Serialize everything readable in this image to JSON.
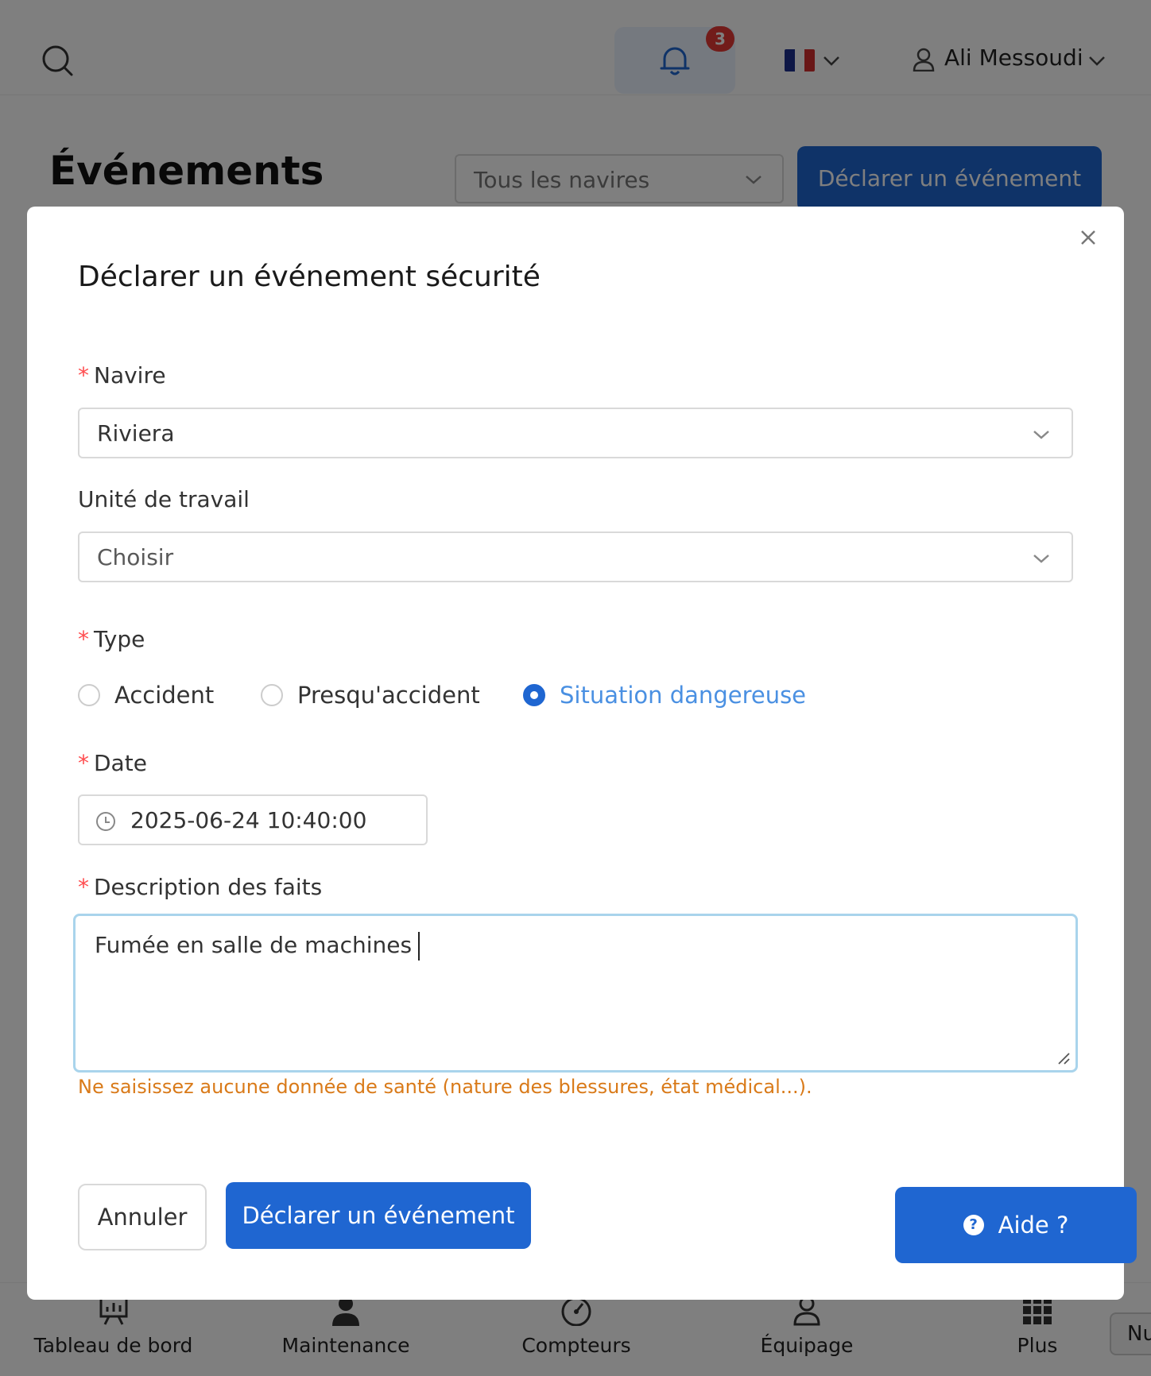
{
  "topbar": {
    "notification_count": "3",
    "language": "FR",
    "user_name": "Ali Messoudi"
  },
  "page": {
    "title": "Événements",
    "vessel_filter": "Tous les navires",
    "declare_button": "Déclarer un événement"
  },
  "modal": {
    "title": "Déclarer un événement sécurité",
    "fields": {
      "vessel": {
        "label": "Navire",
        "value": "Riviera",
        "required": true
      },
      "work_unit": {
        "label": "Unité de travail",
        "placeholder": "Choisir"
      },
      "type": {
        "label": "Type",
        "options": [
          "Accident",
          "Presqu'accident",
          "Situation dangereuse"
        ],
        "selected": "Situation dangereuse"
      },
      "date": {
        "label": "Date",
        "value": "2025-06-24 10:40:00"
      },
      "description": {
        "label": "Description des faits",
        "value": "Fumée en salle de machines",
        "warning": "Ne saisissez aucune donnée de santé (nature des blessures, état médical...)."
      }
    },
    "cancel_label": "Annuler",
    "submit_label": "Déclarer un événement",
    "required_mark": "*"
  },
  "help": {
    "label": "Aide ?",
    "icon": "question-icon"
  },
  "bottom_nav": [
    {
      "label": "Tableau de bord",
      "icon": "dashboard-icon"
    },
    {
      "label": "Maintenance",
      "icon": "maintenance-icon"
    },
    {
      "label": "Compteurs",
      "icon": "gauge-icon"
    },
    {
      "label": "Équipage",
      "icon": "crew-icon"
    },
    {
      "label": "Plus",
      "icon": "grid-icon"
    }
  ],
  "floating_tab": "Nu",
  "colors": {
    "primary": "#1f66d1",
    "warning": "#d97a19",
    "required": "#ff4d4f",
    "badge": "#e53935"
  }
}
